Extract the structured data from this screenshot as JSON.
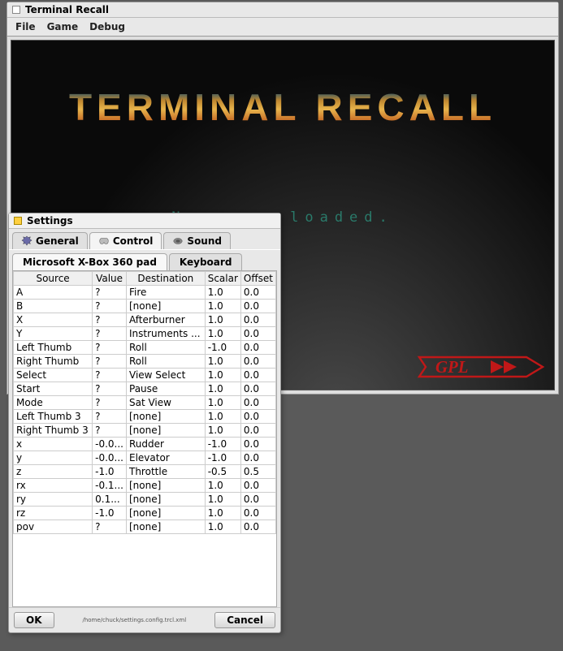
{
  "window": {
    "title": "Terminal Recall",
    "menu": [
      "File",
      "Game",
      "Debug"
    ],
    "game_title": "TERMINAL RECALL",
    "no_game": "No game loaded."
  },
  "settings": {
    "title": "Settings",
    "tabs": {
      "general": "General",
      "control": "Control",
      "sound": "Sound"
    },
    "sub_tabs": {
      "pad": "Microsoft X-Box 360 pad",
      "keyboard": "Keyboard"
    },
    "columns": [
      "Source",
      "Value",
      "Destination",
      "Scalar",
      "Offset"
    ],
    "rows": [
      {
        "src": "A",
        "val": "?",
        "dest": "Fire",
        "scale": "1.0",
        "off": "0.0"
      },
      {
        "src": "B",
        "val": "?",
        "dest": "[none]",
        "scale": "1.0",
        "off": "0.0"
      },
      {
        "src": "X",
        "val": "?",
        "dest": "Afterburner",
        "scale": "1.0",
        "off": "0.0"
      },
      {
        "src": "Y",
        "val": "?",
        "dest": "Instruments ...",
        "scale": "1.0",
        "off": "0.0"
      },
      {
        "src": "Left Thumb",
        "val": "?",
        "dest": "Roll",
        "scale": "-1.0",
        "off": "0.0"
      },
      {
        "src": "Right Thumb",
        "val": "?",
        "dest": "Roll",
        "scale": "1.0",
        "off": "0.0"
      },
      {
        "src": "Select",
        "val": "?",
        "dest": "View Select",
        "scale": "1.0",
        "off": "0.0"
      },
      {
        "src": "Start",
        "val": "?",
        "dest": "Pause",
        "scale": "1.0",
        "off": "0.0"
      },
      {
        "src": "Mode",
        "val": "?",
        "dest": "Sat View",
        "scale": "1.0",
        "off": "0.0"
      },
      {
        "src": "Left Thumb 3",
        "val": "?",
        "dest": "[none]",
        "scale": "1.0",
        "off": "0.0"
      },
      {
        "src": "Right Thumb 3",
        "val": "?",
        "dest": "[none]",
        "scale": "1.0",
        "off": "0.0"
      },
      {
        "src": "x",
        "val": "-0.0...",
        "dest": "Rudder",
        "scale": "-1.0",
        "off": "0.0"
      },
      {
        "src": "y",
        "val": "-0.0...",
        "dest": "Elevator",
        "scale": "-1.0",
        "off": "0.0"
      },
      {
        "src": "z",
        "val": "-1.0",
        "dest": "Throttle",
        "scale": "-0.5",
        "off": "0.5"
      },
      {
        "src": "rx",
        "val": "-0.1...",
        "dest": "[none]",
        "scale": "1.0",
        "off": "0.0"
      },
      {
        "src": "ry",
        "val": "0.1...",
        "dest": "[none]",
        "scale": "1.0",
        "off": "0.0"
      },
      {
        "src": "rz",
        "val": "-1.0",
        "dest": "[none]",
        "scale": "1.0",
        "off": "0.0"
      },
      {
        "src": "pov",
        "val": "?",
        "dest": "[none]",
        "scale": "1.0",
        "off": "0.0"
      }
    ],
    "config_path": "/home/chuck/settings.config.trcl.xml",
    "ok": "OK",
    "cancel": "Cancel"
  }
}
